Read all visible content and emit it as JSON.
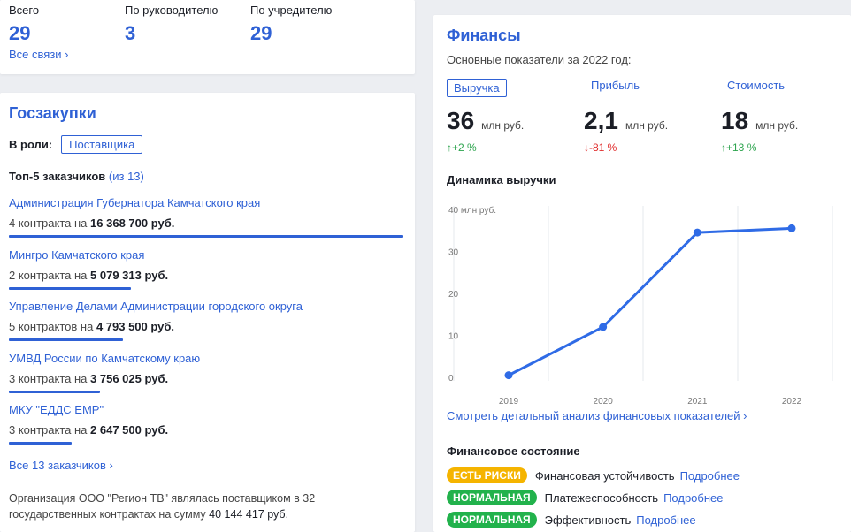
{
  "links": {
    "stats": [
      {
        "label": "Всего",
        "value": "29"
      },
      {
        "label": "По руководителю",
        "value": "3"
      },
      {
        "label": "По учредителю",
        "value": "29"
      }
    ],
    "all_label": "Все связи ›"
  },
  "goszakupki": {
    "title": "Госзакупки",
    "role_label": "В роли:",
    "role_value": "Поставщика",
    "top_label": "Топ-5 заказчиков",
    "top_count": "(из 13)",
    "customers": [
      {
        "name": "Администрация Губернатора Камчатского края",
        "desc": "4 контракта на",
        "amount": "16 368 700 руб.",
        "share": 1.0
      },
      {
        "name": "Мингро Камчатского края",
        "desc": "2 контракта на",
        "amount": "5 079 313 руб.",
        "share": 0.31
      },
      {
        "name": "Управление Делами Администрации городского округа",
        "desc": "5 контрактов на",
        "amount": "4 793 500 руб.",
        "share": 0.29
      },
      {
        "name": "УМВД России по Камчатскому краю",
        "desc": "3 контракта на",
        "amount": "3 756 025 руб.",
        "share": 0.23
      },
      {
        "name": "МКУ \"ЕДДС ЕМР\"",
        "desc": "3 контракта на",
        "amount": "2 647 500 руб.",
        "share": 0.16
      }
    ],
    "all_label": "Все 13 заказчиков ›",
    "note_text": "Организация ООО \"Регион ТВ\" являлась поставщиком в 32 государственных контрактах на сумму",
    "note_amount": "40 144 417 руб."
  },
  "finances": {
    "title": "Финансы",
    "subtitle": "Основные показатели за 2022 год:",
    "metrics": [
      {
        "tab": "Выручка",
        "value": "36",
        "unit": "млн руб.",
        "delta": "↑+2 %",
        "trend": "up"
      },
      {
        "tab": "Прибыль",
        "value": "2,1",
        "unit": "млн руб.",
        "delta": "↓-81 %",
        "trend": "down"
      },
      {
        "tab": "Стоимость",
        "value": "18",
        "unit": "млн руб.",
        "delta": "↑+13 %",
        "trend": "up"
      }
    ],
    "dynamics_title": "Динамика выручки",
    "analysis_link": "Смотреть детальный анализ финансовых показателей ›",
    "state_title": "Финансовое состояние",
    "state_rows": [
      {
        "badge": "ЕСТЬ РИСКИ",
        "color": "#f5b400",
        "label": "Финансовая устойчивость",
        "more": "Подробнее"
      },
      {
        "badge": "НОРМАЛЬНАЯ",
        "color": "#22b24c",
        "label": "Платежеспособность",
        "more": "Подробнее"
      },
      {
        "badge": "НОРМАЛЬНАЯ",
        "color": "#22b24c",
        "label": "Эффективность",
        "more": "Подробнее"
      }
    ]
  },
  "chart_data": {
    "type": "line",
    "title": "Динамика выручки",
    "x": [
      "2019",
      "2020",
      "2021",
      "2022"
    ],
    "series": [
      {
        "values": [
          0.5,
          12,
          34.5,
          35.5
        ]
      }
    ],
    "y_ticks": [
      "40 млн руб.",
      "30",
      "20",
      "10",
      "0"
    ],
    "ylim": [
      0,
      40
    ],
    "grid": "vertical",
    "color": "#2f6be6"
  }
}
